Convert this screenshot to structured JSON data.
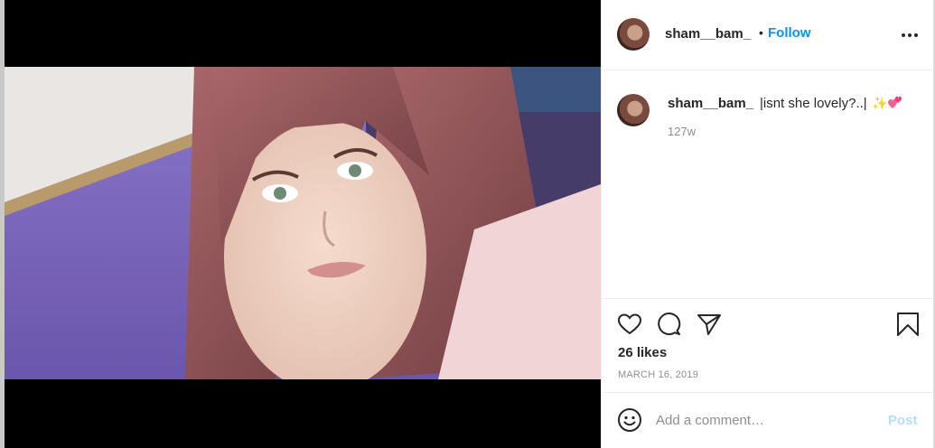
{
  "post": {
    "author": "sham__bam_",
    "follow_separator": "•",
    "follow_label": "Follow",
    "more_icon": "more-options-icon",
    "photo_alt": "Selfie of a young woman with long auburn hair in a room with purple walls"
  },
  "caption": {
    "username": "sham__bam_",
    "text": "|isnt she lovely?..|",
    "emojis": [
      "✨",
      "💕"
    ],
    "time_ago": "127w"
  },
  "actions": {
    "icons": [
      "heart-icon",
      "comment-icon",
      "share-icon",
      "bookmark-icon"
    ],
    "likes": "26 likes",
    "date": "MARCH 16, 2019"
  },
  "comment_box": {
    "placeholder": "Add a comment…",
    "post_label": "Post"
  },
  "colors": {
    "link_blue": "#0095f6",
    "post_disabled": "#b2dffc",
    "muted_text": "#8e8e8e",
    "border": "#efefef"
  }
}
